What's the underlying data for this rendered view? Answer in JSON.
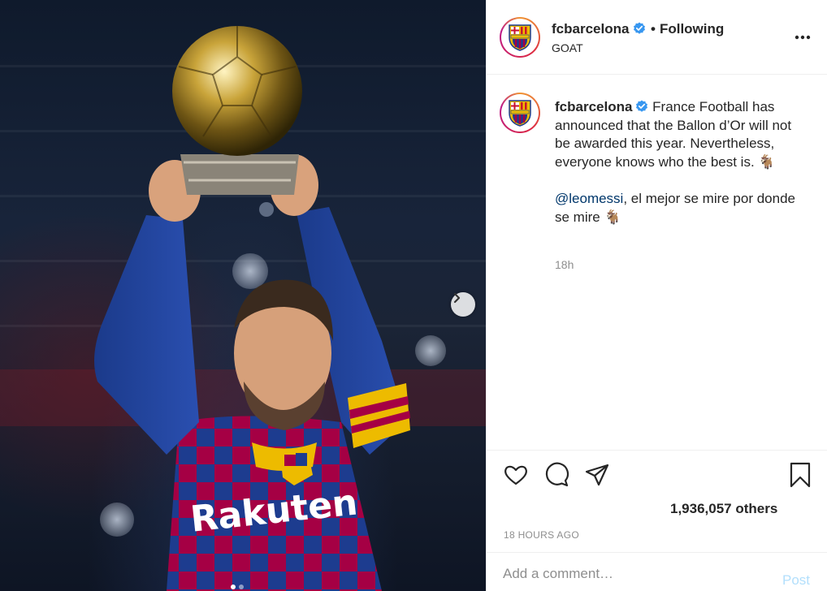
{
  "post": {
    "image_alt": "",
    "jersey_text": "Rakuten"
  },
  "header": {
    "username": "fcbarcelona",
    "separator": "•",
    "follow_status": "Following",
    "location": "GOAT",
    "more_icon": "more-horizontal-icon"
  },
  "caption": {
    "username": "fcbarcelona",
    "text": "France Football has announced that the Ballon d’Or will not be awarded this year. Nevertheless, everyone knows who the best is. 🐐",
    "mention": "@leomessi",
    "mention_text": ", el mejor se mire por donde se mire 🐐",
    "time_ago": "18h"
  },
  "actions": {
    "like_icon": "heart-icon",
    "comment_icon": "comment-icon",
    "share_icon": "share-icon",
    "save_icon": "bookmark-icon",
    "likes_text": "1,936,057 others",
    "posted_at": "18 HOURS AGO"
  },
  "comment": {
    "placeholder": "Add a comment…",
    "post_label": "Post"
  },
  "colors": {
    "verified": "#3897f0",
    "link": "#00376b",
    "muted": "#8e8e8e",
    "post_disabled": "#b2dffc",
    "barca_blue": "#1d3c8f",
    "barca_red": "#a50044",
    "barca_gold": "#edbb00"
  }
}
